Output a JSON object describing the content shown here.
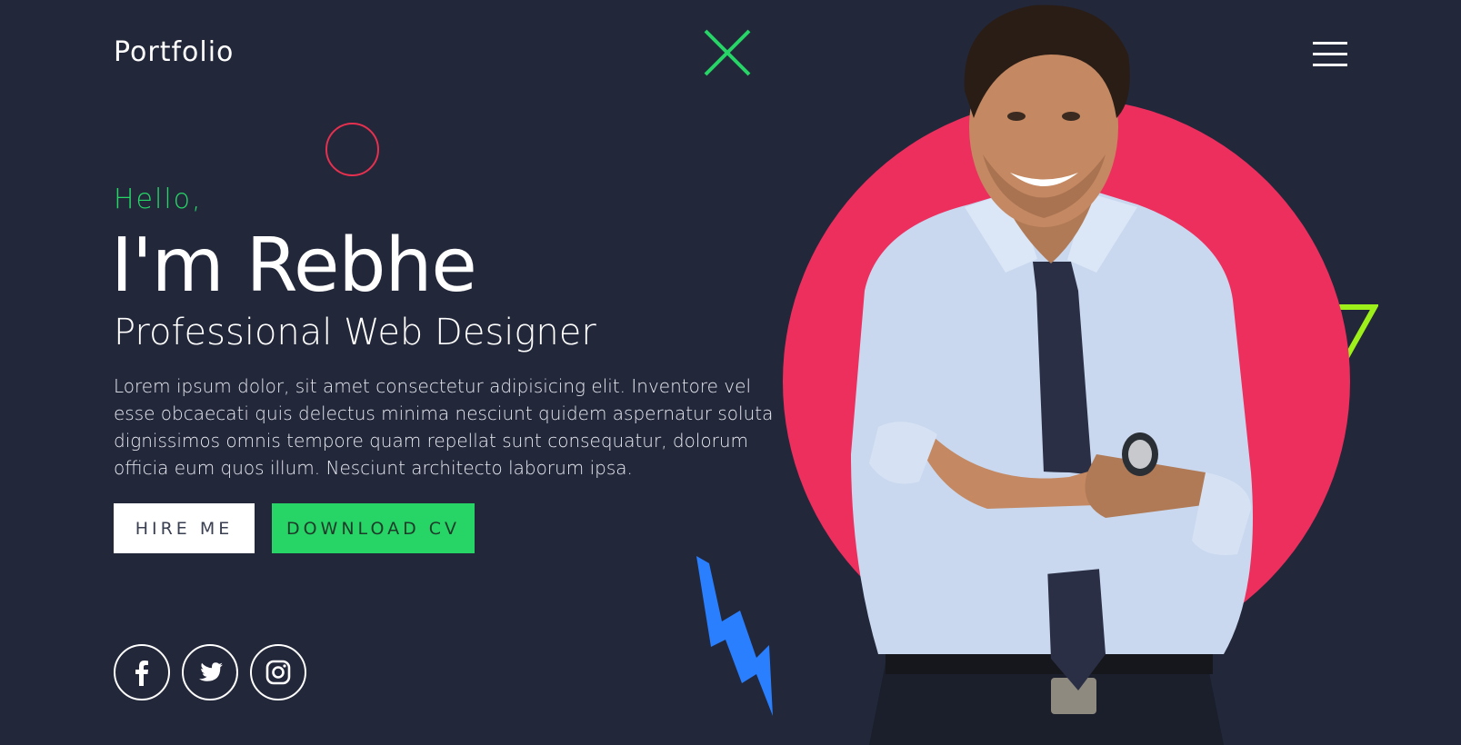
{
  "header": {
    "logo": "Portfolio",
    "menu_icon": "hamburger-menu-icon"
  },
  "hero": {
    "greeting": "Hello,",
    "name": "I'm Rebhe",
    "role": "Professional Web Designer",
    "bio": "Lorem ipsum dolor, sit amet consectetur adipisicing elit. Inventore vel esse obcaecati quis delectus minima nesciunt quidem aspernatur soluta dignissimos omnis tempore quam repellat sunt consequatur, dolorum officia eum quos illum. Nesciunt architecto laborum ipsa.",
    "buttons": {
      "hire": "HIRE ME",
      "download": "DOWNLOAD CV"
    }
  },
  "social": [
    {
      "icon": "facebook-icon"
    },
    {
      "icon": "twitter-icon"
    },
    {
      "icon": "instagram-icon"
    }
  ],
  "colors": {
    "background": "#22273a",
    "accent_green": "#26d566",
    "accent_pink": "#ed2f5e",
    "accent_lime": "#9ef01a",
    "accent_blue": "#2a7fff",
    "circle_red": "#e6304f"
  }
}
